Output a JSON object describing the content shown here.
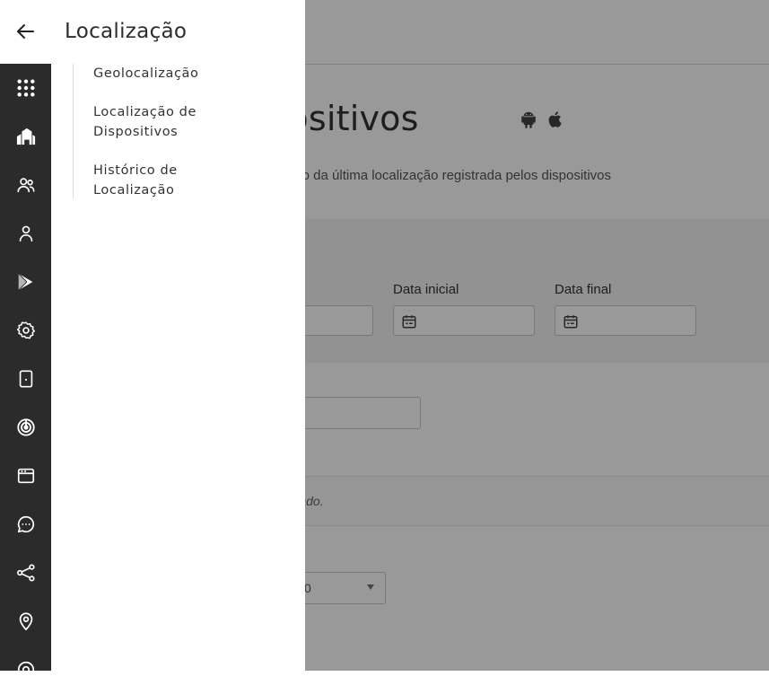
{
  "background": {
    "page_title": "e Dispositivos",
    "subtitle": "ório da última localização registrada pelos dispositivos",
    "filters": {
      "start_date_label": "Data inicial",
      "end_date_label": "Data final"
    },
    "empty_state_text": "ntrado.",
    "page_size_value": "0"
  },
  "drawer": {
    "title": "Localização",
    "submenu": [
      {
        "label": "Geolocalização"
      },
      {
        "label": "Localização de Dispositivos"
      },
      {
        "label": "Histórico de Localização"
      }
    ],
    "rail_icons": [
      "apps-grid-icon",
      "buildings-icon",
      "users-icon",
      "user-icon",
      "play-store-icon",
      "settings-icon",
      "device-icon",
      "radar-icon",
      "browser-window-icon",
      "chat-icon",
      "share-icon",
      "location-pin-icon",
      "help-icon"
    ]
  },
  "colors": {
    "rail_bg": "#2b2b2b",
    "overlay": "rgba(0,0,0,0.4)"
  }
}
